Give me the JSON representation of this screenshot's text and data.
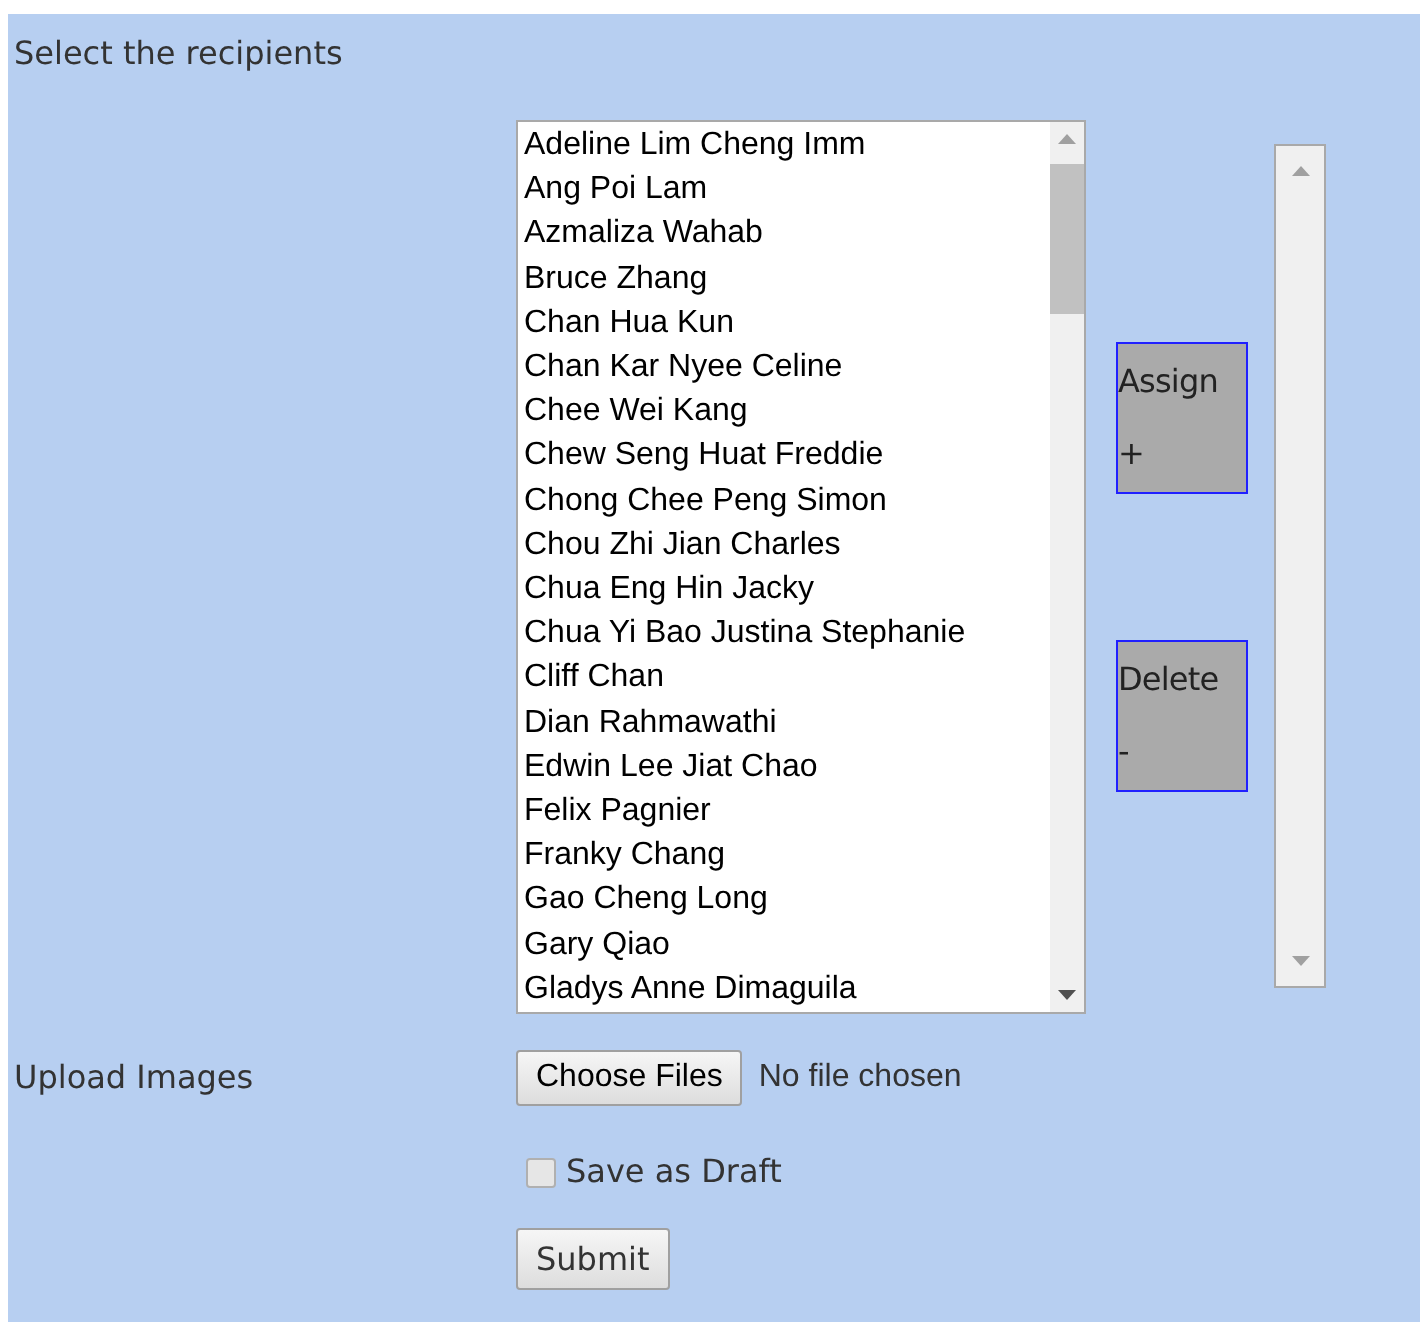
{
  "recipients_label": "Select the recipients",
  "recipients": [
    {
      "name": "Adeline Lim Cheng Imm",
      "selected": false
    },
    {
      "name": "Ang Poi Lam",
      "selected": false
    },
    {
      "name": "Azmaliza Wahab",
      "selected": false
    },
    {
      "name": "Bruce Zhang",
      "selected": false
    },
    {
      "name": "Chan Hua Kun",
      "selected": false
    },
    {
      "name": "Chan Kar Nyee Celine",
      "selected": false
    },
    {
      "name": "Chee Wei Kang",
      "selected": false
    },
    {
      "name": "Chew Seng Huat Freddie",
      "selected": false
    },
    {
      "name": "Chong Chee Peng Simon",
      "selected": false
    },
    {
      "name": "Chou Zhi Jian Charles",
      "selected": false
    },
    {
      "name": "Chua Eng Hin Jacky",
      "selected": false
    },
    {
      "name": "Chua Yi Bao Justina Stephanie",
      "selected": false
    },
    {
      "name": "Cliff Chan",
      "selected": false
    },
    {
      "name": "Dian Rahmawathi",
      "selected": false
    },
    {
      "name": "Edwin Lee Jiat Chao",
      "selected": false
    },
    {
      "name": "Felix Pagnier",
      "selected": false
    },
    {
      "name": "Franky Chang",
      "selected": false
    },
    {
      "name": "Gao Cheng Long",
      "selected": false
    },
    {
      "name": "Gary Qiao",
      "selected": false
    },
    {
      "name": "Gladys Anne Dimaguila",
      "selected": false
    }
  ],
  "assign_button": {
    "label": "Assign",
    "symbol": "+"
  },
  "delete_button": {
    "label": "Delete",
    "symbol": "-"
  },
  "upload_label": "Upload Images",
  "file_button": "Choose Files",
  "file_status": "No file chosen",
  "save_as_draft": {
    "label": "Save as Draft",
    "checked": false
  },
  "submit_button": "Submit"
}
